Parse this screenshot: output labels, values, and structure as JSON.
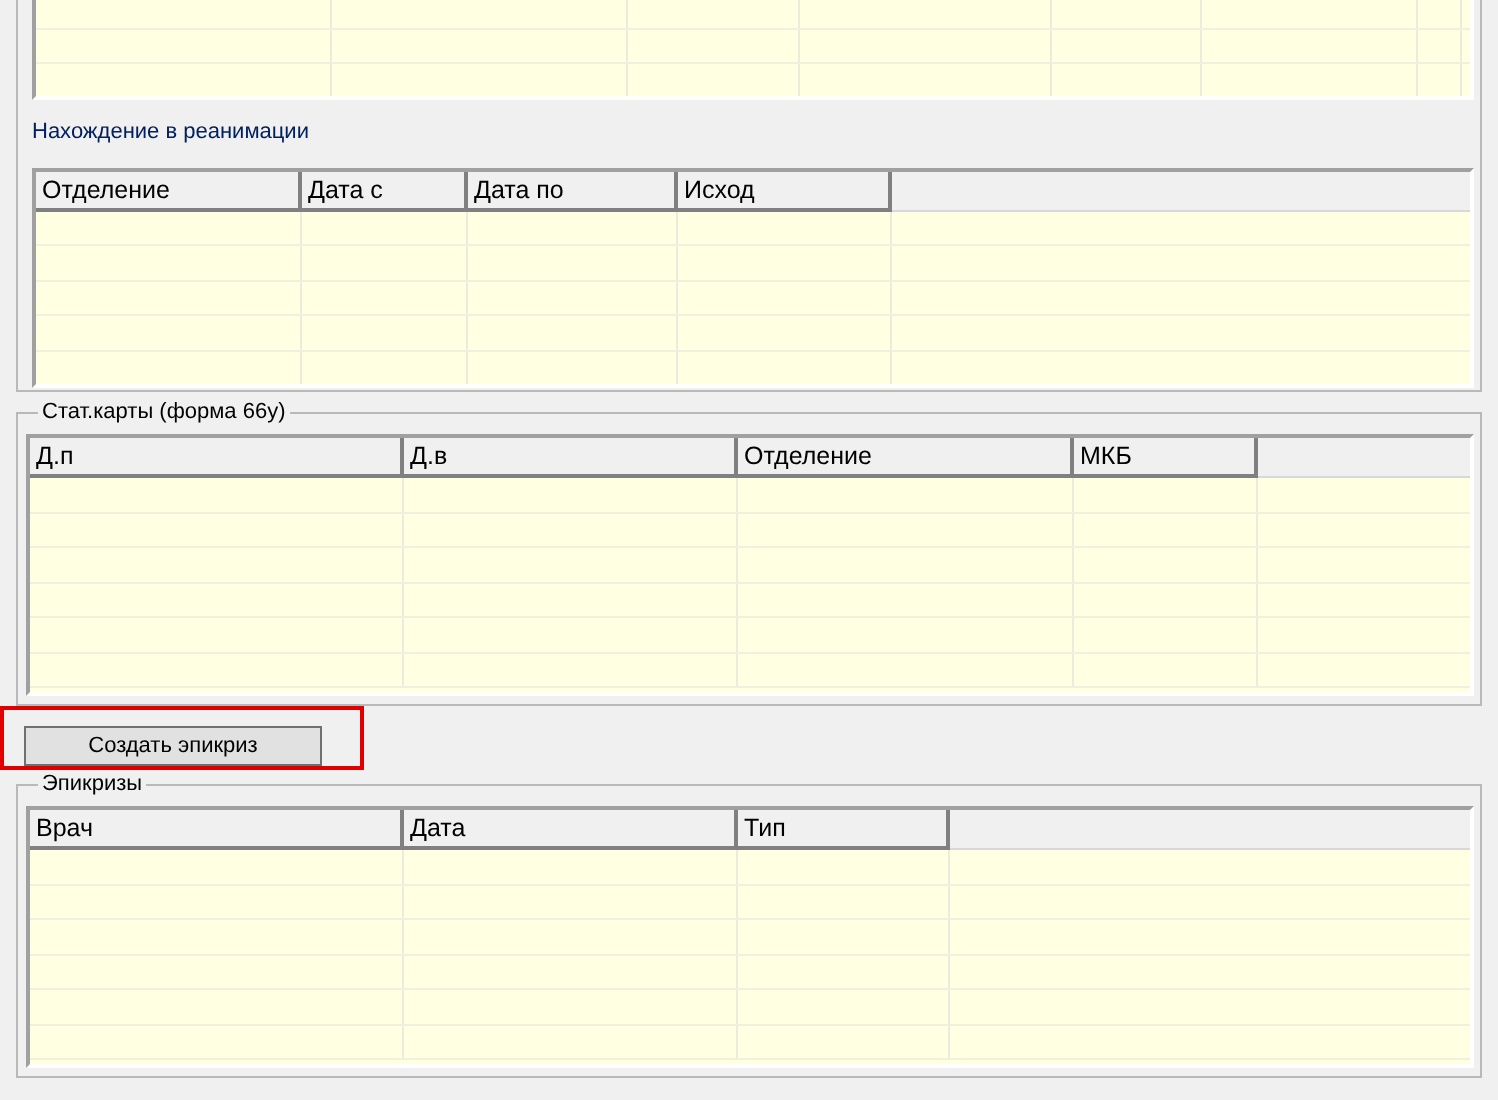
{
  "reanimation": {
    "title": "Нахождение в реанимации",
    "columns": [
      "Отделение",
      "Дата с",
      "Дата по",
      "Исход"
    ]
  },
  "stat_cards": {
    "title": "Стат.карты (форма 66у)",
    "columns": [
      "Д.п",
      "Д.в",
      "Отделение",
      "МКБ"
    ]
  },
  "create_button": {
    "label": "Создать эпикриз",
    "highlighted": true
  },
  "epicrises": {
    "title": "Эпикризы",
    "columns": [
      "Врач",
      "Дата",
      "Тип"
    ]
  }
}
